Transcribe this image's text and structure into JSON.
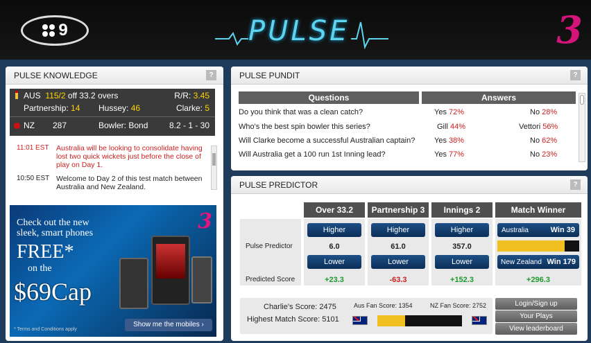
{
  "header": {
    "nine_logo": "9",
    "pulse_title": "PULSE",
    "brand_3": "3"
  },
  "knowledge": {
    "title": "PULSE KNOWLEDGE",
    "help": "?",
    "aus_team": "AUS",
    "aus_score": "115/2",
    "aus_overs": "off 33.2 overs",
    "rr_label": "R/R:",
    "rr_value": "3.45",
    "partnership_label": "Partnership:",
    "partnership_value": "14",
    "hussey_label": "Hussey:",
    "hussey_value": "46",
    "clarke_label": "Clarke:",
    "clarke_value": "5",
    "nz_team": "NZ",
    "nz_score": "287",
    "bowler_label": "Bowler: Bond",
    "bowler_figures": "8.2 - 1 - 30",
    "feed": [
      {
        "time": "11:01 EST",
        "text1": "Australia will be looking to consolidate having",
        "text2": "lost two quick wickets just before the close of",
        "text3": "play on Day 1."
      },
      {
        "time": "10:50 EST",
        "text1": "Welcome to Day 2 of this test match between",
        "text2": "Australia and New Zealand."
      }
    ],
    "ad": {
      "line1": "Check out the new",
      "line2": "sleek, smart phones",
      "free": "FREE*",
      "on_the": "on the",
      "cap": "$69Cap",
      "terms": "* Terms and Conditions apply",
      "cta": "Show me the mobiles ›"
    }
  },
  "pundit": {
    "title": "PULSE PUNDIT",
    "help": "?",
    "col_questions": "Questions",
    "col_answers": "Answers",
    "rows": [
      {
        "q": "Do you think that was a clean catch?",
        "a1": "Yes",
        "p1": "72%",
        "a2": "No",
        "p2": "28%"
      },
      {
        "q": "Who's the best spin bowler this series?",
        "a1": "Gill",
        "p1": "44%",
        "a2": "Vettori",
        "p2": "56%"
      },
      {
        "q": "Will Clarke become a successful Australian captain?",
        "a1": "Yes",
        "p1": "38%",
        "a2": "No",
        "p2": "62%"
      },
      {
        "q": "Will Australia get a 100 run 1st Inning lead?",
        "a1": "Yes",
        "p1": "77%",
        "a2": "No",
        "p2": "23%"
      }
    ]
  },
  "predictor": {
    "title": "PULSE PREDICTOR",
    "help": "?",
    "row_label_pulse": "Pulse Predictor",
    "row_label_predicted": "Predicted Score",
    "columns": [
      {
        "head": "Over 33.2",
        "higher": "Higher",
        "value": "6.0",
        "lower": "Lower",
        "predicted": "+23.3",
        "predicted_color": "green"
      },
      {
        "head": "Partnership 3",
        "higher": "Higher",
        "value": "61.0",
        "lower": "Lower",
        "predicted": "-63.3",
        "predicted_color": "red"
      },
      {
        "head": "Innings 2",
        "higher": "Higher",
        "value": "357.0",
        "lower": "Lower",
        "predicted": "+152.3",
        "predicted_color": "green"
      }
    ],
    "match_winner": {
      "head": "Match Winner",
      "aus_label": "Australia",
      "aus_win": "Win 39",
      "nz_label": "New Zealand",
      "nz_win": "Win 179",
      "predicted": "+296.3",
      "aus_share": 0.82
    },
    "charlie_score": "Charlie's Score: 2475",
    "highest_score": "Highest Match Score: 5101",
    "aus_fan": "Aus Fan Score: 1354",
    "nz_fan": "NZ Fan Score: 2752",
    "fan_aus_share": 0.33,
    "buttons": {
      "login": "Login/Sign up",
      "plays": "Your Plays",
      "leaderboard": "View leaderboard"
    }
  }
}
